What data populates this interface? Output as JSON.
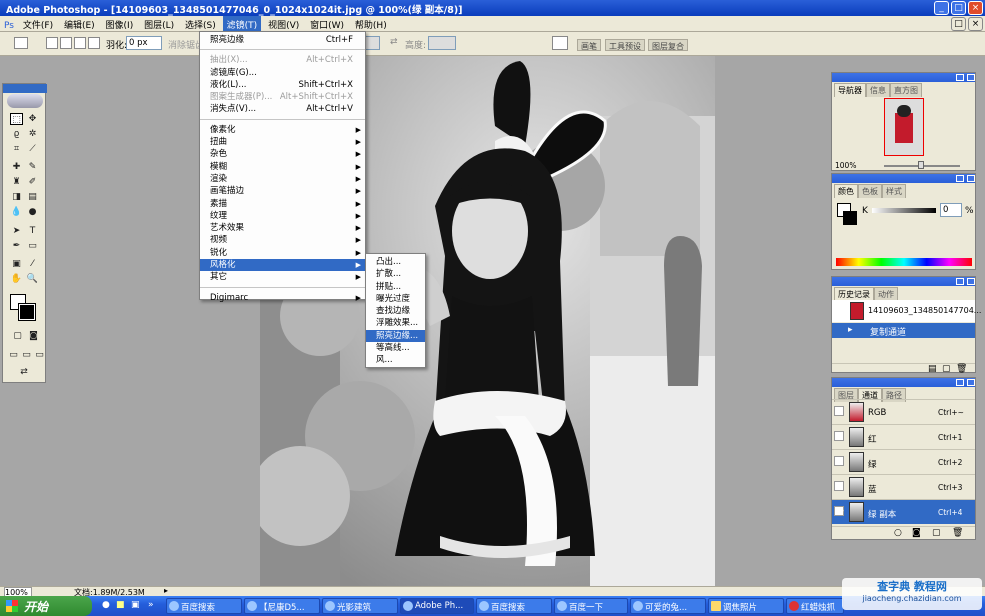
{
  "window": {
    "title": "Adobe Photoshop - [14109603_1348501477046_0_1024x1024it.jpg @ 100%(绿 副本/8)]"
  },
  "menubar": [
    "文件(F)",
    "编辑(E)",
    "图像(I)",
    "图层(L)",
    "选择(S)",
    "滤镜(T)",
    "视图(V)",
    "窗口(W)",
    "帮助(H)"
  ],
  "options": {
    "feather_label": "羽化:",
    "feather_value": "0 px",
    "antialias": "消除锯齿",
    "height_label": "高度:"
  },
  "workspace_tabs": [
    "画笔",
    "工具预设",
    "图层复合"
  ],
  "filter_menu": [
    {
      "label": "照亮边缘",
      "shortcut": "Ctrl+F"
    },
    {
      "sep": true
    },
    {
      "label": "抽出(X)...",
      "shortcut": "Alt+Ctrl+X",
      "disabled": true
    },
    {
      "label": "滤镜库(G)..."
    },
    {
      "label": "液化(L)...",
      "shortcut": "Shift+Ctrl+X"
    },
    {
      "label": "图案生成器(P)...",
      "shortcut": "Alt+Shift+Ctrl+X",
      "disabled": true
    },
    {
      "label": "消失点(V)...",
      "shortcut": "Alt+Ctrl+V"
    },
    {
      "sep": true
    },
    {
      "label": "像素化",
      "sub": true
    },
    {
      "label": "扭曲",
      "sub": true
    },
    {
      "label": "杂色",
      "sub": true
    },
    {
      "label": "模糊",
      "sub": true
    },
    {
      "label": "渲染",
      "sub": true
    },
    {
      "label": "画笔描边",
      "sub": true
    },
    {
      "label": "素描",
      "sub": true
    },
    {
      "label": "纹理",
      "sub": true
    },
    {
      "label": "艺术效果",
      "sub": true
    },
    {
      "label": "视频",
      "sub": true
    },
    {
      "label": "锐化",
      "sub": true
    },
    {
      "label": "风格化",
      "sub": true,
      "highlight": true
    },
    {
      "label": "其它",
      "sub": true
    },
    {
      "sep": true
    },
    {
      "label": "Digimarc",
      "sub": true
    }
  ],
  "stylize_submenu": [
    {
      "label": "凸出..."
    },
    {
      "label": "扩散..."
    },
    {
      "label": "拼贴..."
    },
    {
      "label": "曝光过度"
    },
    {
      "label": "查找边缘"
    },
    {
      "label": "浮雕效果..."
    },
    {
      "label": "照亮边缘...",
      "highlight": true
    },
    {
      "label": "等高线..."
    },
    {
      "label": "风..."
    }
  ],
  "navigator": {
    "tabs": [
      "导航器",
      "信息",
      "直方图"
    ],
    "zoom": "100%"
  },
  "color": {
    "tabs": [
      "颜色",
      "色板",
      "样式"
    ],
    "channel": "K",
    "value": "0",
    "unit": "%"
  },
  "history": {
    "tabs": [
      "历史记录",
      "动作"
    ],
    "snapshot": "14109603_134850147704...",
    "step": "复制通道"
  },
  "channels": {
    "tabs": [
      "图层",
      "通道",
      "路径"
    ],
    "rows": [
      {
        "name": "RGB",
        "shortcut": "Ctrl+~"
      },
      {
        "name": "红",
        "shortcut": "Ctrl+1"
      },
      {
        "name": "绿",
        "shortcut": "Ctrl+2"
      },
      {
        "name": "蓝",
        "shortcut": "Ctrl+3"
      },
      {
        "name": "绿 副本",
        "shortcut": "Ctrl+4",
        "selected": true
      }
    ]
  },
  "status": {
    "zoom": "100%",
    "doc": "文档:1.89M/2.53M"
  },
  "taskbar": {
    "start": "开始",
    "tasks": [
      "百度搜索",
      "【尼康D5...",
      "光影建筑",
      "Adobe Ph...",
      "百度搜索",
      "百度一下",
      "可爱的兔...",
      "调焦照片",
      "红蜡烛抓"
    ]
  },
  "watermark": {
    "line1": "查字典 教程网",
    "line2": "jiaocheng.chazidian.com"
  }
}
